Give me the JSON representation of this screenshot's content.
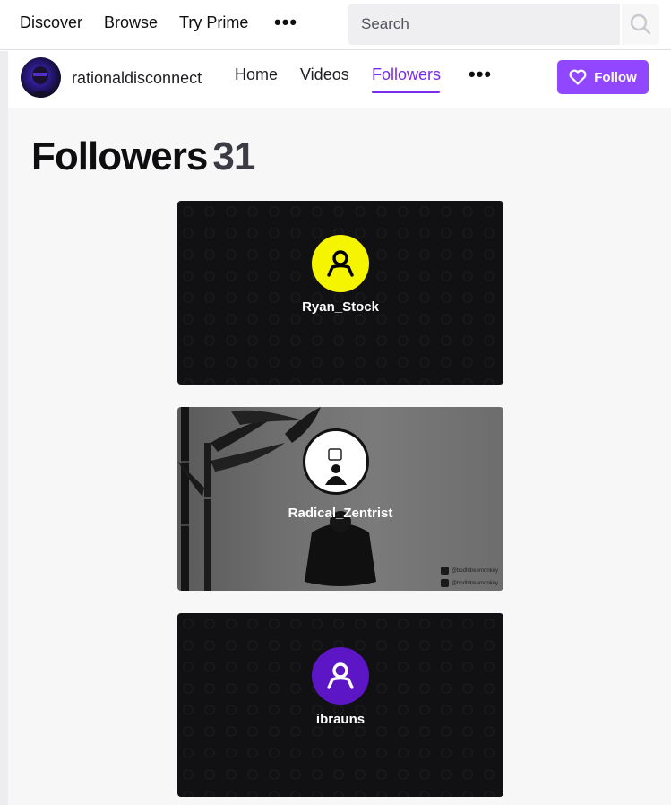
{
  "topnav": {
    "links": [
      "Discover",
      "Browse",
      "Try Prime"
    ],
    "more": "•••",
    "search_placeholder": "Search"
  },
  "channel": {
    "name": "rationaldisconnect",
    "tabs": [
      "Home",
      "Videos",
      "Followers"
    ],
    "active_tab": "Followers",
    "more": "•••",
    "follow_label": "Follow"
  },
  "page": {
    "title": "Followers",
    "count": "31"
  },
  "followers": [
    {
      "username": "Ryan_Stock",
      "avatar_color": "#f5f500",
      "icon_color": "#000000"
    },
    {
      "username": "Radical_Zentrist",
      "social_handles": [
        "@bodhitreemonkey",
        "@bodhitreemonkey"
      ]
    },
    {
      "username": "ibrauns",
      "avatar_color": "#5c16c5",
      "icon_color": "#ffffff"
    }
  ],
  "colors": {
    "accent": "#772ce8",
    "button": "#9147ff"
  }
}
